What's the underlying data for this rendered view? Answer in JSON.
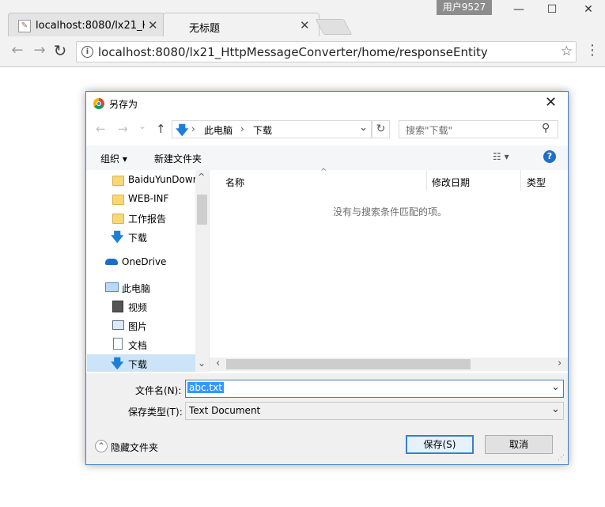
{
  "browser": {
    "user_badge": "用户9527",
    "tabs": [
      {
        "label": "localhost:8080/lx21_Ht",
        "close": "✕"
      },
      {
        "label": "无标题",
        "close": "✕"
      }
    ],
    "window_controls": {
      "minimize": "—",
      "maximize": "☐",
      "close": "✕"
    },
    "nav": {
      "back": "←",
      "forward": "→",
      "reload": "↻"
    },
    "url": "localhost:8080/lx21_HttpMessageConverter/home/responseEntity",
    "star": "☆",
    "menu": "⋮"
  },
  "dialog": {
    "title": "另存为",
    "close": "✕",
    "nav": {
      "back": "←",
      "forward": "→",
      "dropdown": "⌄",
      "up": "↑"
    },
    "breadcrumb": {
      "sep": "›",
      "items": [
        "此电脑",
        "下载"
      ],
      "chevron": "⌄"
    },
    "refresh": "↻",
    "search_placeholder": "搜索\"下载\"",
    "search_icon": "⚲",
    "toolbar": {
      "organize": "组织 ▾",
      "new_folder": "新建文件夹",
      "view": "☷ ▾",
      "help": "?"
    },
    "sidebar": [
      {
        "label": "BaiduYunDown",
        "icon": "folder-icon"
      },
      {
        "label": "WEB-INF",
        "icon": "folder-icon"
      },
      {
        "label": "工作报告",
        "icon": "folder-icon"
      },
      {
        "label": "下载",
        "icon": "download-icon"
      },
      {
        "label": "OneDrive",
        "icon": "cloud-icon"
      },
      {
        "label": "此电脑",
        "icon": "computer-icon"
      },
      {
        "label": "视频",
        "icon": "video-icon"
      },
      {
        "label": "图片",
        "icon": "picture-icon"
      },
      {
        "label": "文档",
        "icon": "document-icon"
      },
      {
        "label": "下载",
        "icon": "download-icon"
      }
    ],
    "columns": [
      "名称",
      "修改日期",
      "类型"
    ],
    "sort_indicator": "^",
    "empty_message": "没有与搜索条件匹配的项。",
    "filename_label": "文件名(N):",
    "filename_value": "abc.txt",
    "filetype_label": "保存类型(T):",
    "filetype_value": "Text Document",
    "hide_folders": "隐藏文件夹",
    "save_button": "保存(S)",
    "cancel_button": "取消",
    "scroll": {
      "up": "^",
      "down": "⌄",
      "left": "‹",
      "right": "›"
    }
  }
}
